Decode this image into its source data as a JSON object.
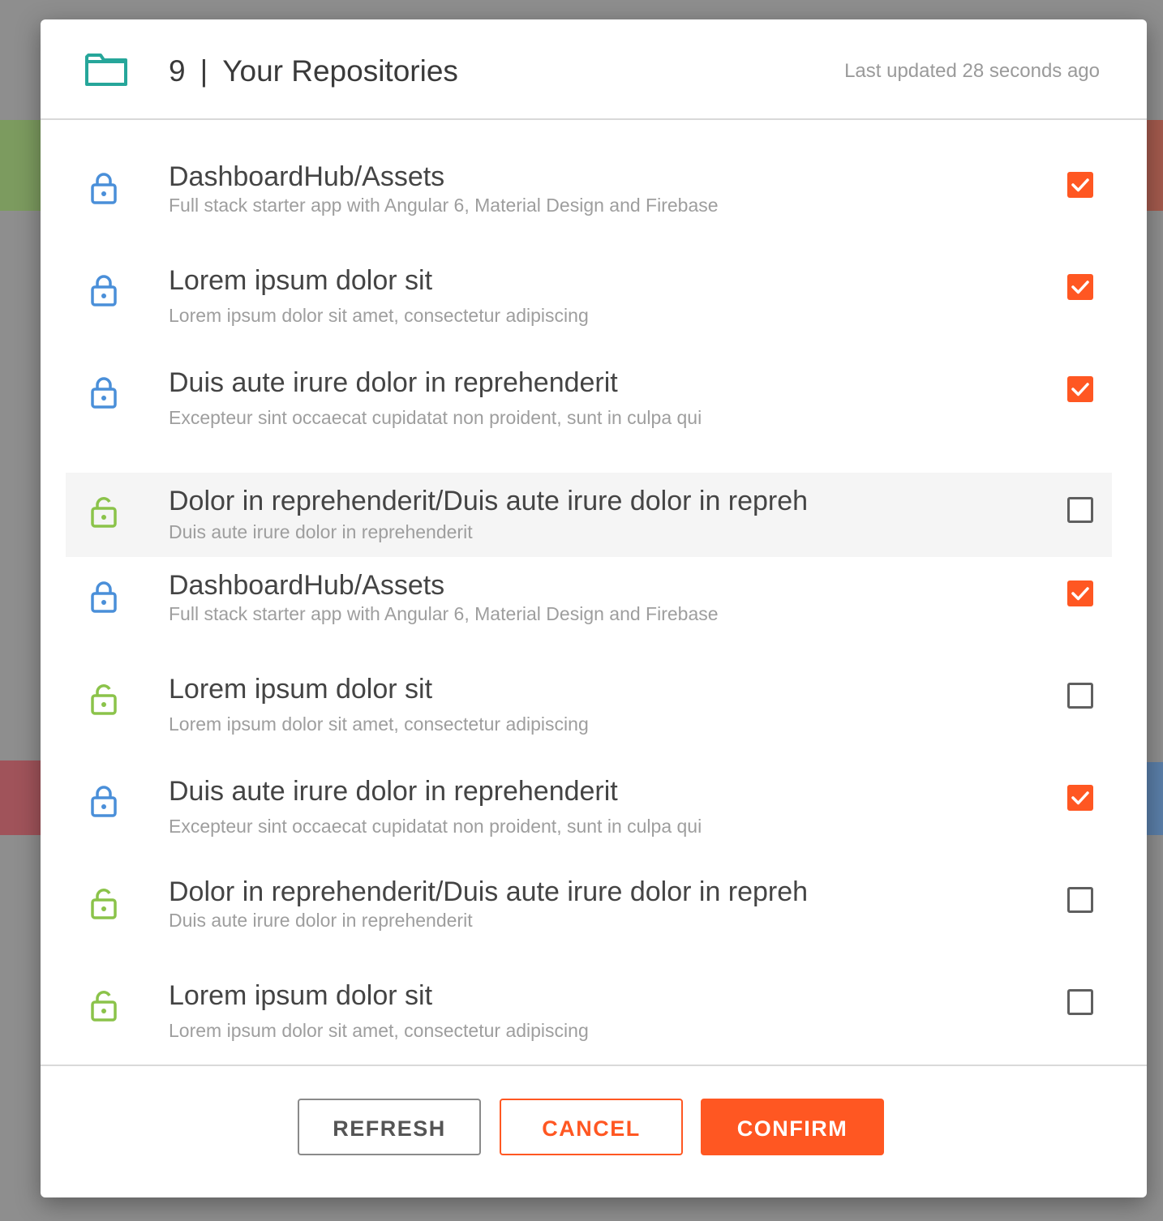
{
  "header": {
    "count": "9",
    "separator": "|",
    "title": "Your Repositories",
    "last_updated": "Last updated 28 seconds ago",
    "icon": "folder-icon"
  },
  "repos": [
    {
      "name": "DashboardHub/Assets",
      "description": "Full stack starter app with Angular 6, Material Design and Firebase",
      "private": true,
      "selected": true
    },
    {
      "name": "Lorem ipsum dolor sit",
      "description": "Lorem ipsum dolor sit amet, consectetur adipiscing",
      "private": true,
      "selected": true
    },
    {
      "name": "Duis aute irure dolor in reprehenderit",
      "description": "Excepteur sint occaecat cupidatat non proident, sunt in culpa qui",
      "private": true,
      "selected": true
    },
    {
      "name": "Dolor in reprehenderit/Duis aute irure dolor in repreh",
      "description": "Duis aute irure dolor in reprehenderit",
      "private": false,
      "selected": false
    },
    {
      "name": "DashboardHub/Assets",
      "description": "Full stack starter app with Angular 6, Material Design and Firebase",
      "private": true,
      "selected": true
    },
    {
      "name": "Lorem ipsum dolor sit",
      "description": "Lorem ipsum dolor sit amet, consectetur adipiscing",
      "private": false,
      "selected": false
    },
    {
      "name": "Duis aute irure dolor in reprehenderit",
      "description": "Excepteur sint occaecat cupidatat non proident, sunt in culpa qui",
      "private": true,
      "selected": true
    },
    {
      "name": "Dolor in reprehenderit/Duis aute irure dolor in repreh",
      "description": "Duis aute irure dolor in reprehenderit",
      "private": false,
      "selected": false
    },
    {
      "name": "Lorem ipsum dolor sit",
      "description": "Lorem ipsum dolor sit amet, consectetur adipiscing",
      "private": false,
      "selected": false
    }
  ],
  "buttons": {
    "refresh": "REFRESH",
    "cancel": "CANCEL",
    "confirm": "CONFIRM"
  },
  "colors": {
    "accent": "#ff5722",
    "folder": "#26a69a",
    "lock_private": "#4a8fd9",
    "lock_public": "#8bc34a"
  }
}
